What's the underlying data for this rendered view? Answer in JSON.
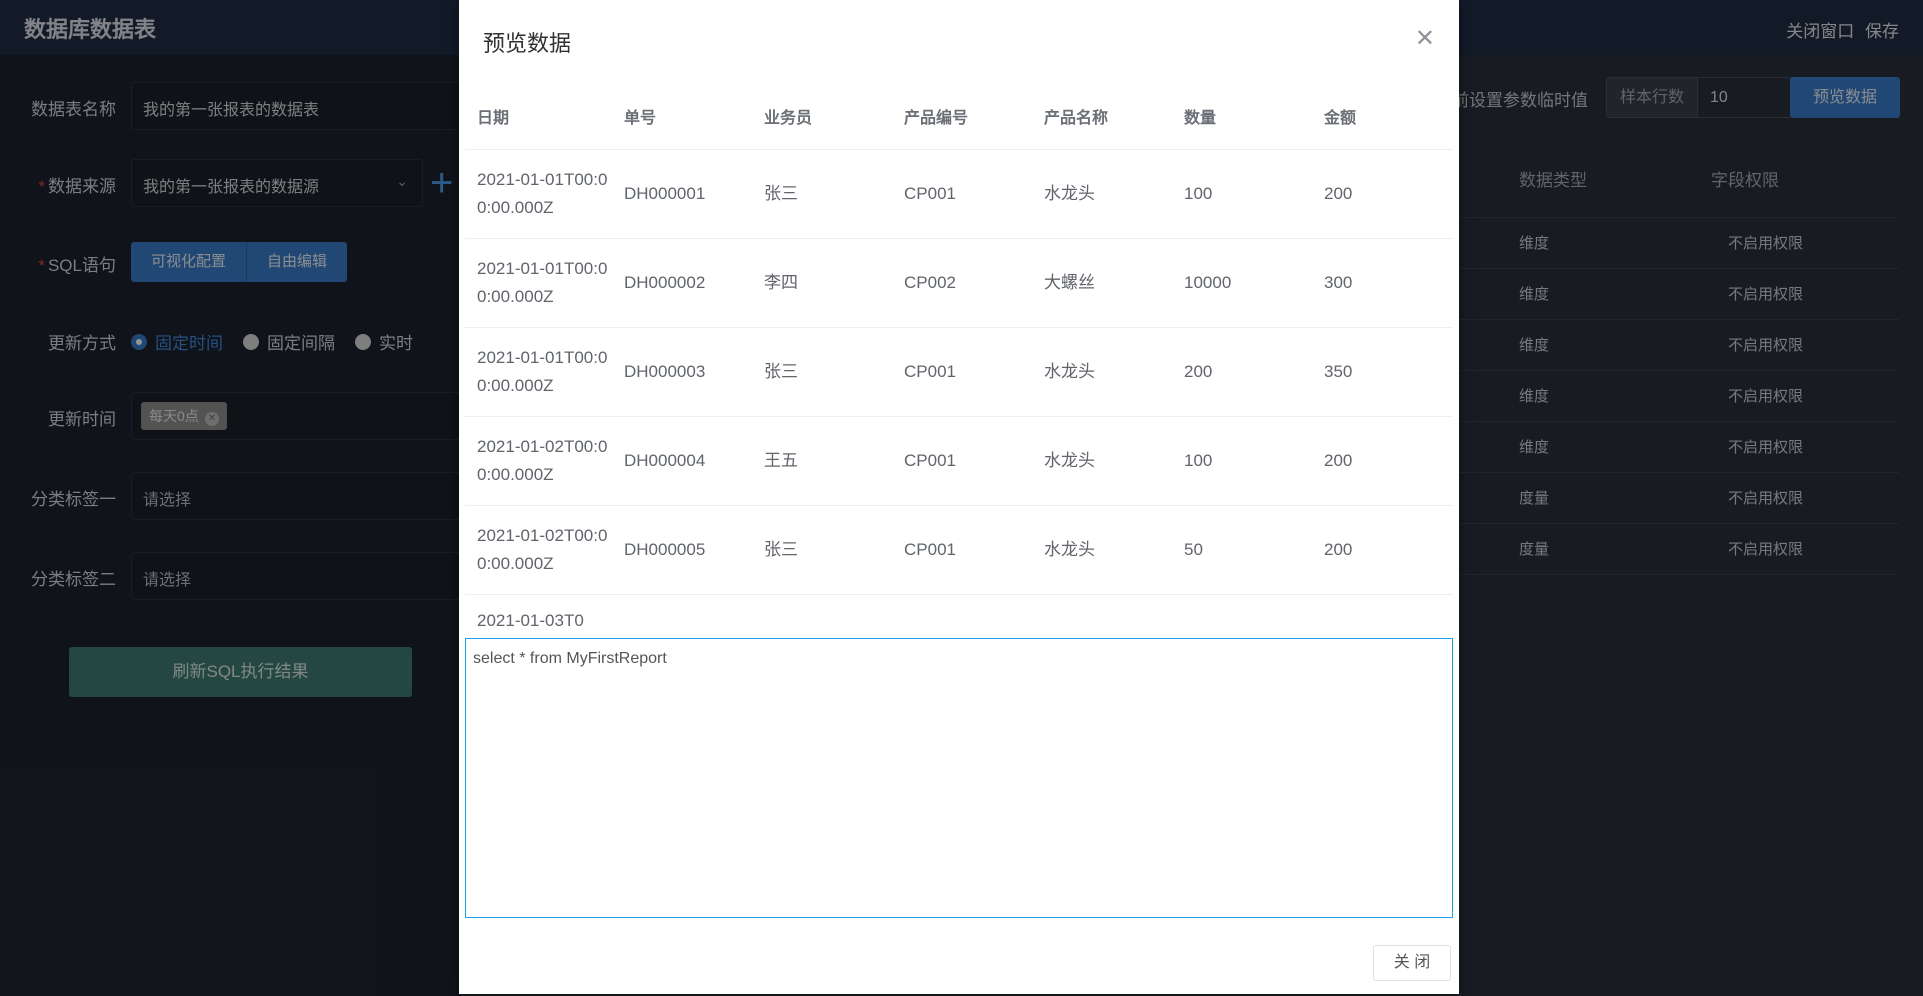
{
  "header": {
    "title": "数据库数据表",
    "close_window": "关闭窗口",
    "save": "保存"
  },
  "form": {
    "table_name": {
      "label": "数据表名称",
      "value": "我的第一张报表的数据表"
    },
    "data_source": {
      "label": "数据来源",
      "value": "我的第一张报表的数据源"
    },
    "sql": {
      "label": "SQL语句",
      "visual_config": "可视化配置",
      "free_edit": "自由编辑"
    },
    "update_mode": {
      "label": "更新方式",
      "options": [
        "固定时间",
        "固定间隔",
        "实时"
      ],
      "selected": "固定时间"
    },
    "update_time": {
      "label": "更新时间",
      "tag": "每天0点"
    },
    "category1": {
      "label": "分类标签一",
      "placeholder": "请选择"
    },
    "category2": {
      "label": "分类标签二",
      "placeholder": "请选择"
    },
    "refresh_button": "刷新SQL执行结果"
  },
  "right_panel": {
    "param_text": "前设置参数临时值",
    "sample_rows_label": "样本行数",
    "sample_rows_value": "10",
    "preview_button": "预览数据",
    "columns": [
      "数据类型",
      "字段权限"
    ],
    "rows": [
      [
        "维度",
        "不启用权限"
      ],
      [
        "维度",
        "不启用权限"
      ],
      [
        "维度",
        "不启用权限"
      ],
      [
        "维度",
        "不启用权限"
      ],
      [
        "维度",
        "不启用权限"
      ],
      [
        "度量",
        "不启用权限"
      ],
      [
        "度量",
        "不启用权限"
      ]
    ]
  },
  "modal": {
    "title": "预览数据",
    "columns": [
      "日期",
      "单号",
      "业务员",
      "产品编号",
      "产品名称",
      "数量",
      "金额"
    ],
    "rows": [
      [
        "2021-01-01T00:00:00.000Z",
        "DH000001",
        "张三",
        "CP001",
        "水龙头",
        "100",
        "200"
      ],
      [
        "2021-01-01T00:00:00.000Z",
        "DH000002",
        "李四",
        "CP002",
        "大螺丝",
        "10000",
        "300"
      ],
      [
        "2021-01-01T00:00:00.000Z",
        "DH000003",
        "张三",
        "CP001",
        "水龙头",
        "200",
        "350"
      ],
      [
        "2021-01-02T00:00:00.000Z",
        "DH000004",
        "王五",
        "CP001",
        "水龙头",
        "100",
        "200"
      ],
      [
        "2021-01-02T00:00:00.000Z",
        "DH000005",
        "张三",
        "CP001",
        "水龙头",
        "50",
        "200"
      ],
      [
        "2021-01-03T0",
        "",
        "",
        "",
        "",
        "",
        ""
      ]
    ],
    "sql": "select * from MyFirstReport",
    "close_button": "关 闭"
  }
}
